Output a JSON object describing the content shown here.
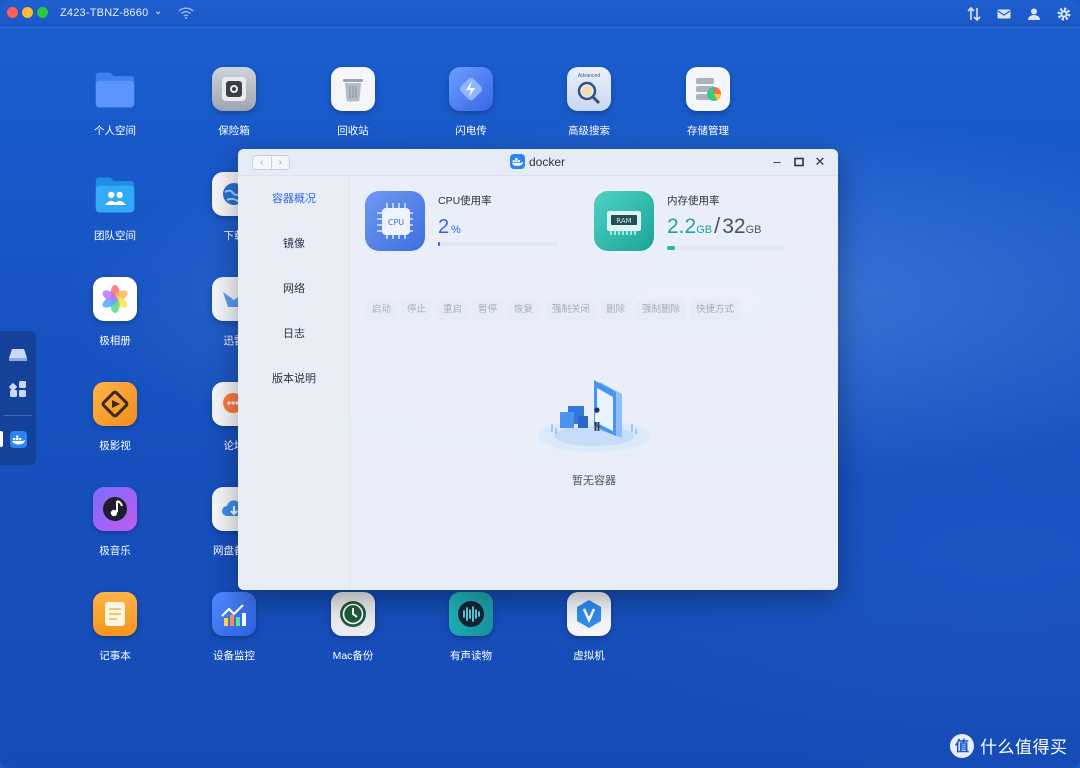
{
  "topbar": {
    "device_name": "Z423-TBNZ-8660",
    "icons": [
      "wifi-icon",
      "transfer-icon",
      "mail-icon",
      "user-icon",
      "gear-icon"
    ]
  },
  "apps": [
    {
      "label": "个人空间",
      "icon": "folder-icon"
    },
    {
      "label": "保险箱",
      "icon": "safe-icon"
    },
    {
      "label": "回收站",
      "icon": "trash-icon"
    },
    {
      "label": "闪电传",
      "icon": "lightning-icon"
    },
    {
      "label": "高级搜索",
      "icon": "search-icon",
      "badge": "Advanced"
    },
    {
      "label": "存储管理",
      "icon": "storage-icon"
    },
    {
      "label": "团队空间",
      "icon": "team-folder-icon"
    },
    {
      "label": "下载",
      "icon": "globe-icon"
    },
    {
      "label": "极相册",
      "icon": "photos-icon"
    },
    {
      "label": "迅雷",
      "icon": "thunder-icon"
    },
    {
      "label": "极影视",
      "icon": "video-icon"
    },
    {
      "label": "论坛",
      "icon": "forum-icon"
    },
    {
      "label": "极音乐",
      "icon": "music-icon"
    },
    {
      "label": "网盘备份",
      "icon": "cloud-icon"
    },
    {
      "label": "记事本",
      "icon": "notes-icon"
    },
    {
      "label": "设备监控",
      "icon": "monitor-icon"
    },
    {
      "label": "Mac备份",
      "icon": "timemachine-icon"
    },
    {
      "label": "有声读物",
      "icon": "audiobook-icon"
    },
    {
      "label": "虚拟机",
      "icon": "vm-icon"
    }
  ],
  "window": {
    "title": "docker",
    "sidebar": [
      "容器概况",
      "镜像",
      "网络",
      "日志",
      "版本说明"
    ],
    "cpu": {
      "label": "CPU使用率",
      "value": "2",
      "unit": "%",
      "icon_text": "CPU",
      "usage": 0.02
    },
    "memory": {
      "label": "内存使用率",
      "used": "2.2",
      "used_unit": "GB",
      "sep": "/",
      "total": "32",
      "total_unit": "GB",
      "icon_text": "RAM",
      "usage": 0.069
    },
    "buttons": [
      "启动",
      "停止",
      "重启",
      "暂停",
      "恢复",
      "强制关闭",
      "删除",
      "强制删除",
      "快捷方式"
    ],
    "empty_text": "暂无容器"
  },
  "watermark": {
    "logo": "值",
    "text": "什么值得买"
  },
  "colors": {
    "accent": "#2f66e8",
    "memory_accent": "#1aa89a",
    "cpu_icon": "#3e6fe0"
  }
}
